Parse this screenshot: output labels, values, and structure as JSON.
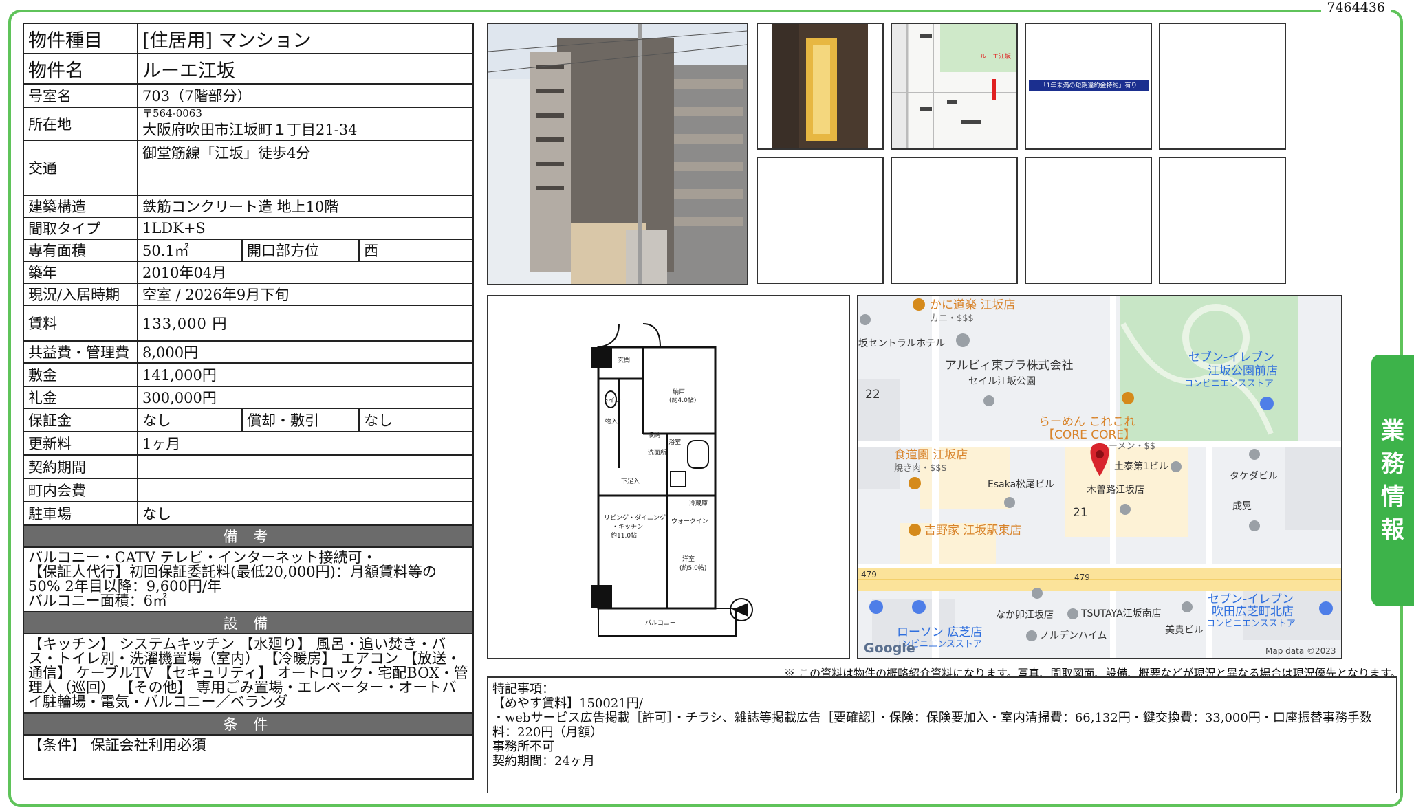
{
  "doc_id": "7464436",
  "side_tab": [
    "業",
    "務",
    "情",
    "報"
  ],
  "property": {
    "type_label": "物件種目",
    "type_value": "[住居用] マンション",
    "name_label": "物件名",
    "name_value": "ルーエ江坂",
    "room_label": "号室名",
    "room_value": "703（7階部分）",
    "address_label": "所在地",
    "postal": "〒564-0063",
    "address": "大阪府吹田市江坂町１丁目21-34",
    "transit_label": "交通",
    "transit_value": "御堂筋線「江坂」徒歩4分",
    "structure_label": "建築構造",
    "structure_value": "鉄筋コンクリート造 地上10階",
    "layout_label": "間取タイプ",
    "layout_value": "1LDK+S",
    "area_label": "専有面積",
    "area_value": "50.1㎡",
    "facing_label": "開口部方位",
    "facing_value": "西",
    "built_label": "築年",
    "built_value": "2010年04月",
    "status_label": "現況/入居時期",
    "status_value": "空室 / 2026年9月下旬",
    "rent_label": "賃料",
    "rent_value": "133,000 円",
    "fee_label": "共益費・管理費",
    "fee_value": "8,000円",
    "deposit_label": "敷金",
    "deposit_value": "141,000円",
    "keymoney_label": "礼金",
    "keymoney_value": "300,000円",
    "guarantee_label": "保証金",
    "guarantee_value": "なし",
    "amort_label": "償却・敷引",
    "amort_value": "なし",
    "renewal_label": "更新料",
    "renewal_value": "1ヶ月",
    "contract_label": "契約期間",
    "contract_value": "",
    "community_label": "町内会費",
    "community_value": "",
    "parking_label": "駐車場",
    "parking_value": "なし"
  },
  "remarks": {
    "heading": "備 考",
    "lines": [
      "バルコニー・CATV テレビ・インターネット接続可・",
      "【保証人代行】初回保証委託料(最低20,000円)：月額賃料等の50% 2年目以降：9,600円/年",
      "バルコニー面積：6㎡"
    ]
  },
  "facilities": {
    "heading": "設 備",
    "text": "【キッチン】 システムキッチン 【水廻り】 風呂・追い焚き・バス・トイレ別・洗濯機置場（室内） 【冷暖房】 エアコン 【放送・通信】 ケーブルTV 【セキュリティ】 オートロック・宅配BOX・管理人（巡回） 【その他】 専用ごみ置場・エレベーター・オートバイ駐輪場・電気・バルコニー／ベランダ"
  },
  "conditions": {
    "heading": "条 件",
    "text": "【条件】 保証会社利用必須"
  },
  "thumb_banner": "「1年未満の短期違約金特約」有り",
  "map_thumb_label": "ルーエ江坂",
  "floorplan": {
    "rooms": [
      "玄関",
      "納戸",
      "(約4.0帖)",
      "トイレ",
      "物入",
      "洗面所",
      "浴室",
      "収納",
      "リビング・ダイニング",
      "・キッチン",
      "約11.0帖",
      "洋室",
      "(約5.0帖)",
      "バルコニー",
      "冷蔵庫",
      "下足入",
      "ウォークイン"
    ]
  },
  "map": {
    "labels": [
      "かに道楽 江坂店",
      "カニ・$$$",
      "坂セントラルホテル",
      "アルビィ東プラ株式会社",
      "セイル江坂公園",
      "22",
      "セブン-イレブン",
      "江坂公園前店",
      "コンビニエンスストア",
      "らーめん これこれ",
      "【CORE CORE】",
      "ーメン・$$",
      "食道園 江坂店",
      "焼き肉・$$$",
      "土泰第1ビル",
      "タケダビル",
      "Esaka松尾ビル",
      "木曽路江坂店",
      "21",
      "成晃",
      "吉野家 江坂駅東店",
      "479",
      "479",
      "なか卯江坂店",
      "TSUTAYA江坂南店",
      "セブン-イレブン",
      "吹田広芝町北店",
      "コンビニエンスストア",
      "美貴ビル",
      "ローソン 広芝店",
      "コンビニエンスストア",
      "ノルデンハイム",
      "Google",
      "Map data ©2023"
    ]
  },
  "disclaimer": "※ この資料は物件の概略紹介資料になります。写真、間取図面、設備、概要などが現況と異なる場合は現況優先となります。",
  "special": {
    "lines": [
      "特記事項：",
      "【めやす賃料】150021円/",
      "・webサービス広告掲載［許可］・チラシ、雑誌等掲載広告［要確認］・保険：保険要加入・室内清掃費：66,132円・鍵交換費：33,000円・口座振替事務手数料：220円（月額）",
      "事務所不可",
      "契約期間：24ヶ月"
    ]
  },
  "colors": {
    "frame": "#5fc35a",
    "side_tab": "#3db34a",
    "section_header": "#6b6b6b"
  }
}
